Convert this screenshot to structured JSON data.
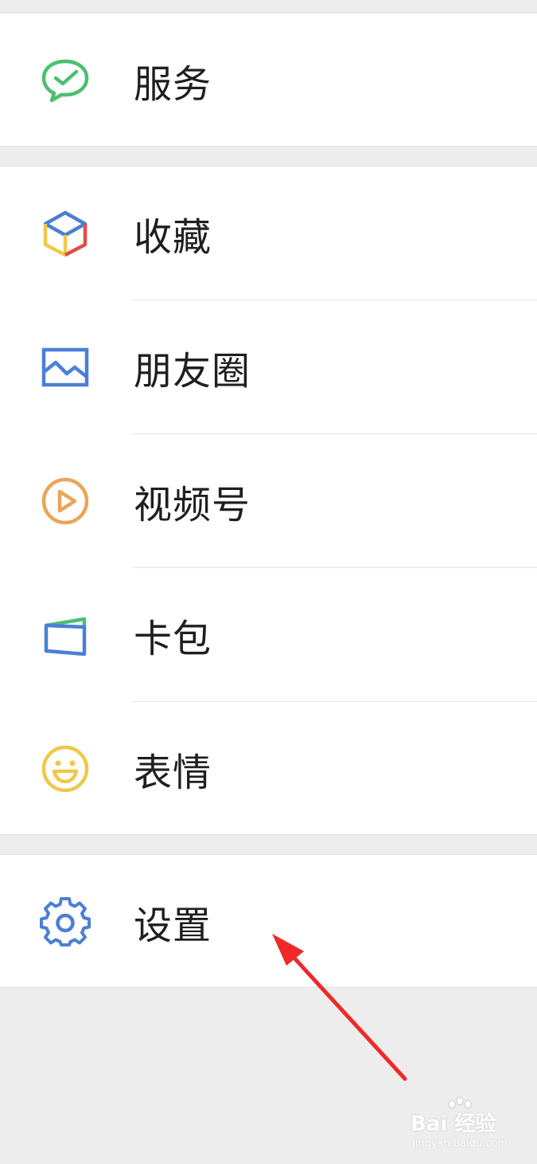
{
  "menu": {
    "services": {
      "label": "服务",
      "icon": "wechat-pay-icon"
    },
    "favorites": {
      "label": "收藏",
      "icon": "cube-icon"
    },
    "moments": {
      "label": "朋友圈",
      "icon": "picture-icon"
    },
    "channels": {
      "label": "视频号",
      "icon": "play-icon"
    },
    "cards": {
      "label": "卡包",
      "icon": "wallet-icon"
    },
    "stickers": {
      "label": "表情",
      "icon": "smiley-icon"
    },
    "settings": {
      "label": "设置",
      "icon": "gear-icon"
    }
  },
  "colors": {
    "green": "#4cbf72",
    "blue": "#4a7fd6",
    "orange": "#e8a657",
    "yellow": "#efc84a",
    "red": "#e14b4b",
    "arrow": "#f02828"
  },
  "watermark": {
    "main": "Bai  经验",
    "sub": "jingyan.baidu.com"
  }
}
